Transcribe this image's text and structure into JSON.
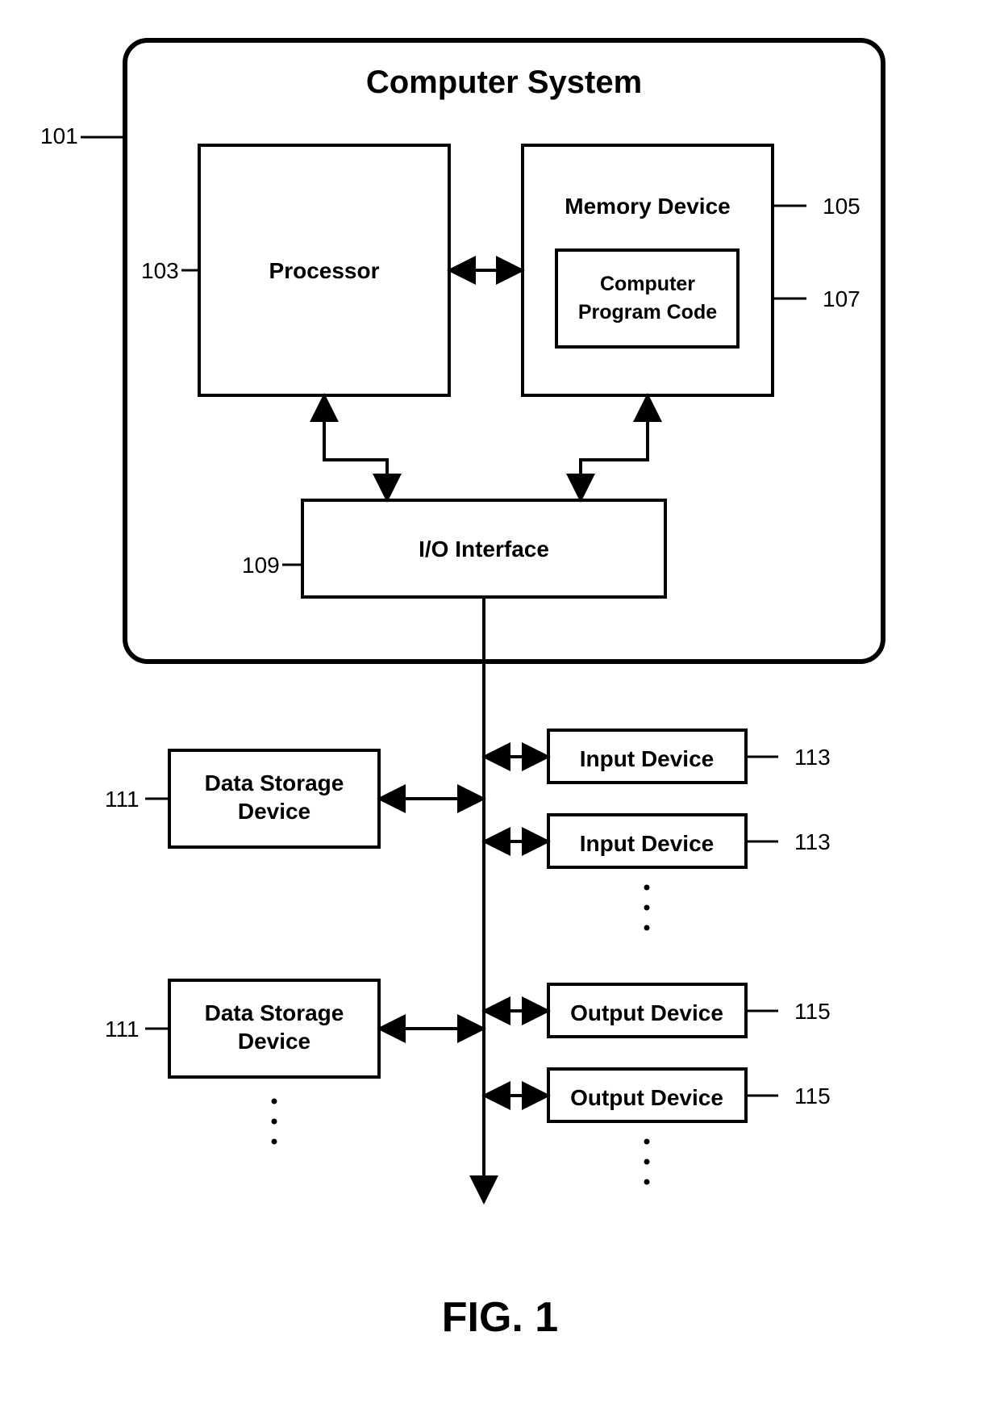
{
  "figure_label": "FIG. 1",
  "system": {
    "title": "Computer System",
    "ref": "101",
    "processor": {
      "label": "Processor",
      "ref": "103"
    },
    "memory": {
      "label": "Memory Device",
      "ref": "105",
      "program_code": {
        "label_l1": "Computer",
        "label_l2": "Program Code",
        "ref": "107"
      }
    },
    "io": {
      "label": "I/O Interface",
      "ref": "109"
    }
  },
  "storage": {
    "label_l1": "Data Storage",
    "label_l2": "Device",
    "ref": "111"
  },
  "input": {
    "label": "Input Device",
    "ref": "113"
  },
  "output": {
    "label": "Output Device",
    "ref": "115"
  }
}
